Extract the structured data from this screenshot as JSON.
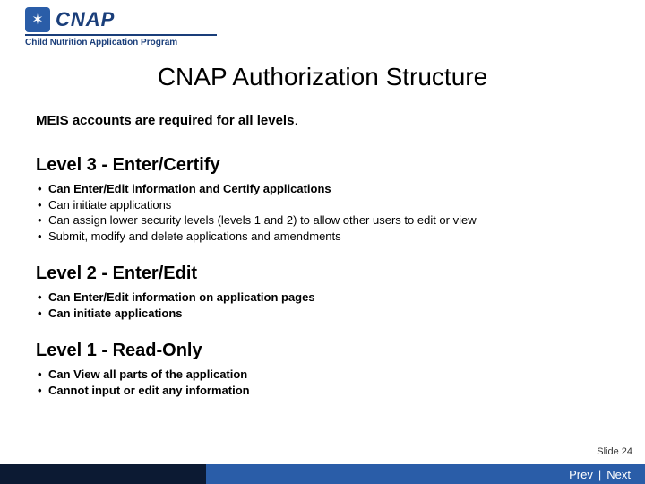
{
  "logo": {
    "acronym": "CNAP",
    "subtitle": "Child Nutrition Application Program",
    "icon_glyph": "✶"
  },
  "title": "CNAP Authorization Structure",
  "intro": "MEIS accounts are required for all levels",
  "sections": [
    {
      "heading": "Level 3 -  Enter/Certify",
      "bullets": [
        {
          "text": "Can Enter/Edit information and Certify applications",
          "bold": true
        },
        {
          "text": "Can initiate applications",
          "bold": false
        },
        {
          "text": "Can assign lower security levels (levels 1 and 2) to allow other users to edit or view",
          "bold": false
        },
        {
          "text": "Submit, modify and delete applications and amendments",
          "bold": false
        }
      ]
    },
    {
      "heading": "Level 2 -  Enter/Edit",
      "bullets": [
        {
          "text": "Can Enter/Edit information on application pages",
          "bold": true
        },
        {
          "text": "Can initiate applications",
          "bold": true
        }
      ]
    },
    {
      "heading": "Level 1 -  Read-Only",
      "bullets": [
        {
          "text": "Can View all parts of the application",
          "bold": true
        },
        {
          "text": "Cannot input or edit any information",
          "bold": true
        }
      ]
    }
  ],
  "footer": {
    "slide_label": "Slide 24",
    "prev": "Prev",
    "next": "Next",
    "sep": "|"
  }
}
